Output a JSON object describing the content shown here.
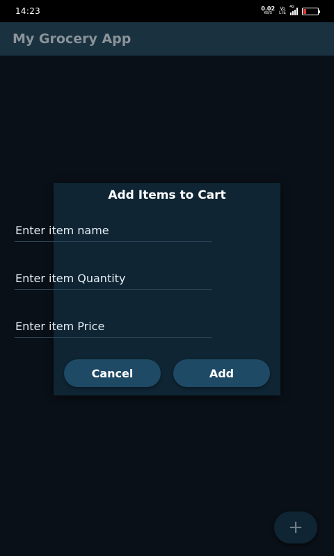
{
  "status_bar": {
    "time": "14:23",
    "net_speed": "0.02",
    "net_speed_unit": "KB/S",
    "volte_top": "Vo",
    "volte_bottom": "LTE",
    "network_type": "4G",
    "battery_color": "#e53935"
  },
  "app_bar": {
    "title": "My Grocery App"
  },
  "dialog": {
    "title": "Add Items to Cart",
    "fields": {
      "item_name": {
        "value": "",
        "placeholder": "Enter item name"
      },
      "item_quantity": {
        "value": "",
        "placeholder": "Enter item Quantity"
      },
      "item_price": {
        "value": "",
        "placeholder": "Enter item Price"
      }
    },
    "cancel_label": "Cancel",
    "add_label": "Add"
  },
  "fab": {
    "icon": "plus-icon",
    "glyph": "+"
  },
  "colors": {
    "background": "#0a1017",
    "app_bar": "#1a3140",
    "dialog": "#0f2533",
    "button": "#1f4a66"
  }
}
